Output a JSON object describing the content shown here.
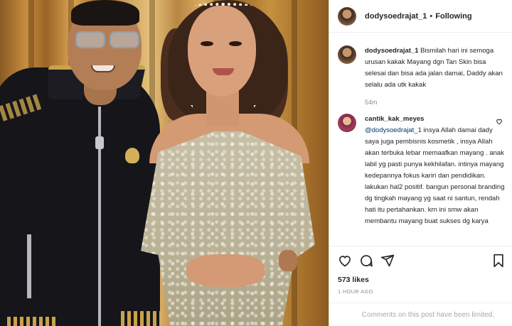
{
  "header": {
    "username": "dodysoedrajat_1",
    "separator": "•",
    "follow_status": "Following"
  },
  "caption": {
    "username": "dodysoedrajat_1",
    "text": "Bismilah hari ini semoga urusan kakak Mayang dgn Tan Skin bisa selesai dan bisa ada jalan damai, Daddy akan selalu ada utk kakak",
    "time": "54m"
  },
  "comment": {
    "username": "cantik_kak_meyes",
    "mention": "@dodysoedrajat_1",
    "text": "insya Allah damai dady saya juga pembisnis kosmetik , insya Allah akan terbuka lebar memaafkan mayang . anak labil yg pasti punya kekhilafan. intinya mayang kedepannya fokus kariri dan pendidikan. lakukan hal2 positif. bangun personal branding dg tingkah mayang yg saat ni santun, rendah hati itu pertahankan. krn ini smw akan membantu mayang buat sukses dg karya"
  },
  "icons": {
    "like": "heart-icon",
    "comment": "comment-icon",
    "share": "send-icon",
    "save": "bookmark-icon",
    "comment_like": "heart-icon-small"
  },
  "stats": {
    "likes": "573 likes",
    "time": "1 HOUR AGO"
  },
  "footer": {
    "limited": "Comments on this post have been limited."
  }
}
